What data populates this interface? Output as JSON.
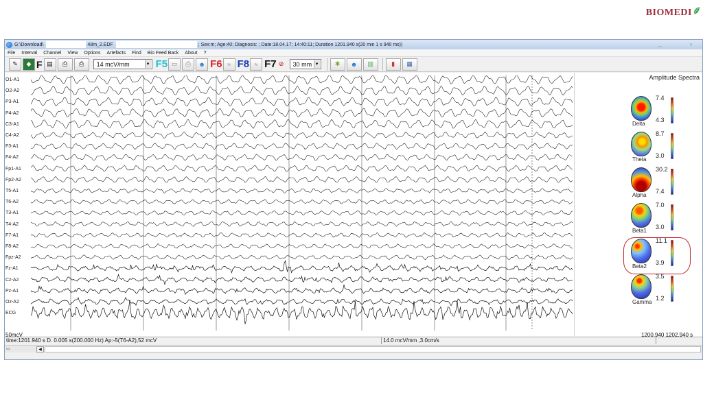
{
  "brand": {
    "text": "BIOMEDI"
  },
  "window": {
    "title_path": "G:\\Download\\",
    "title_file": "48m_2.EDF",
    "title_info": "; Sex:m; Age:40; Diagnosis: ; Date:18.04.17; 14:40:11; Duration 1201.940 s(20 min 1 s 940 ms))"
  },
  "menu": [
    "File",
    "Interval",
    "Channel",
    "View",
    "Options",
    "Artefacts",
    "Find",
    "Bio Feed Back",
    "About",
    "?"
  ],
  "toolbar": {
    "sensitivity": "14 mcV/mm",
    "speed": "30 mm",
    "fkeys": [
      "F5",
      "F6",
      "F8",
      "F7"
    ],
    "f_plain": "F"
  },
  "channels": [
    "O1-A1",
    "O2-A2",
    "P3-A1",
    "P4-A2",
    "C3-A1",
    "C4-A2",
    "F3-A1",
    "F4-A2",
    "Fp1-A1",
    "Fp2-A2",
    "T5-A1",
    "T6-A2",
    "T3-A1",
    "T4-A2",
    "F7-A1",
    "F8-A2",
    "Fpz-A2",
    "Fz-A1",
    "Cz-A2",
    "Pz-A1",
    "Oz-A2",
    "ECG"
  ],
  "scale_label": "50mcV",
  "spectra": {
    "title": "Amplitude Spectra",
    "bands": [
      {
        "name": "Delta",
        "max": "7.4",
        "min": "4.3"
      },
      {
        "name": "Theta",
        "max": "8.7",
        "min": "3.0"
      },
      {
        "name": "Alpha",
        "max": "30.2",
        "min": "7.4"
      },
      {
        "name": "Beta1",
        "max": "7.0",
        "min": "3.0"
      },
      {
        "name": "Beta2",
        "max": "11.1",
        "min": "3.9"
      },
      {
        "name": "Gamma",
        "max": "3.5",
        "min": "1.2"
      }
    ],
    "time_range": "1200.940 1202.940 s"
  },
  "status": {
    "left": "time:1201.940 s D.  0.005 s(200.000 Hz) Ap:-5(T6-A2),52 mcV",
    "middle": "14.0 mcV/mm ,3.0cm/s"
  }
}
